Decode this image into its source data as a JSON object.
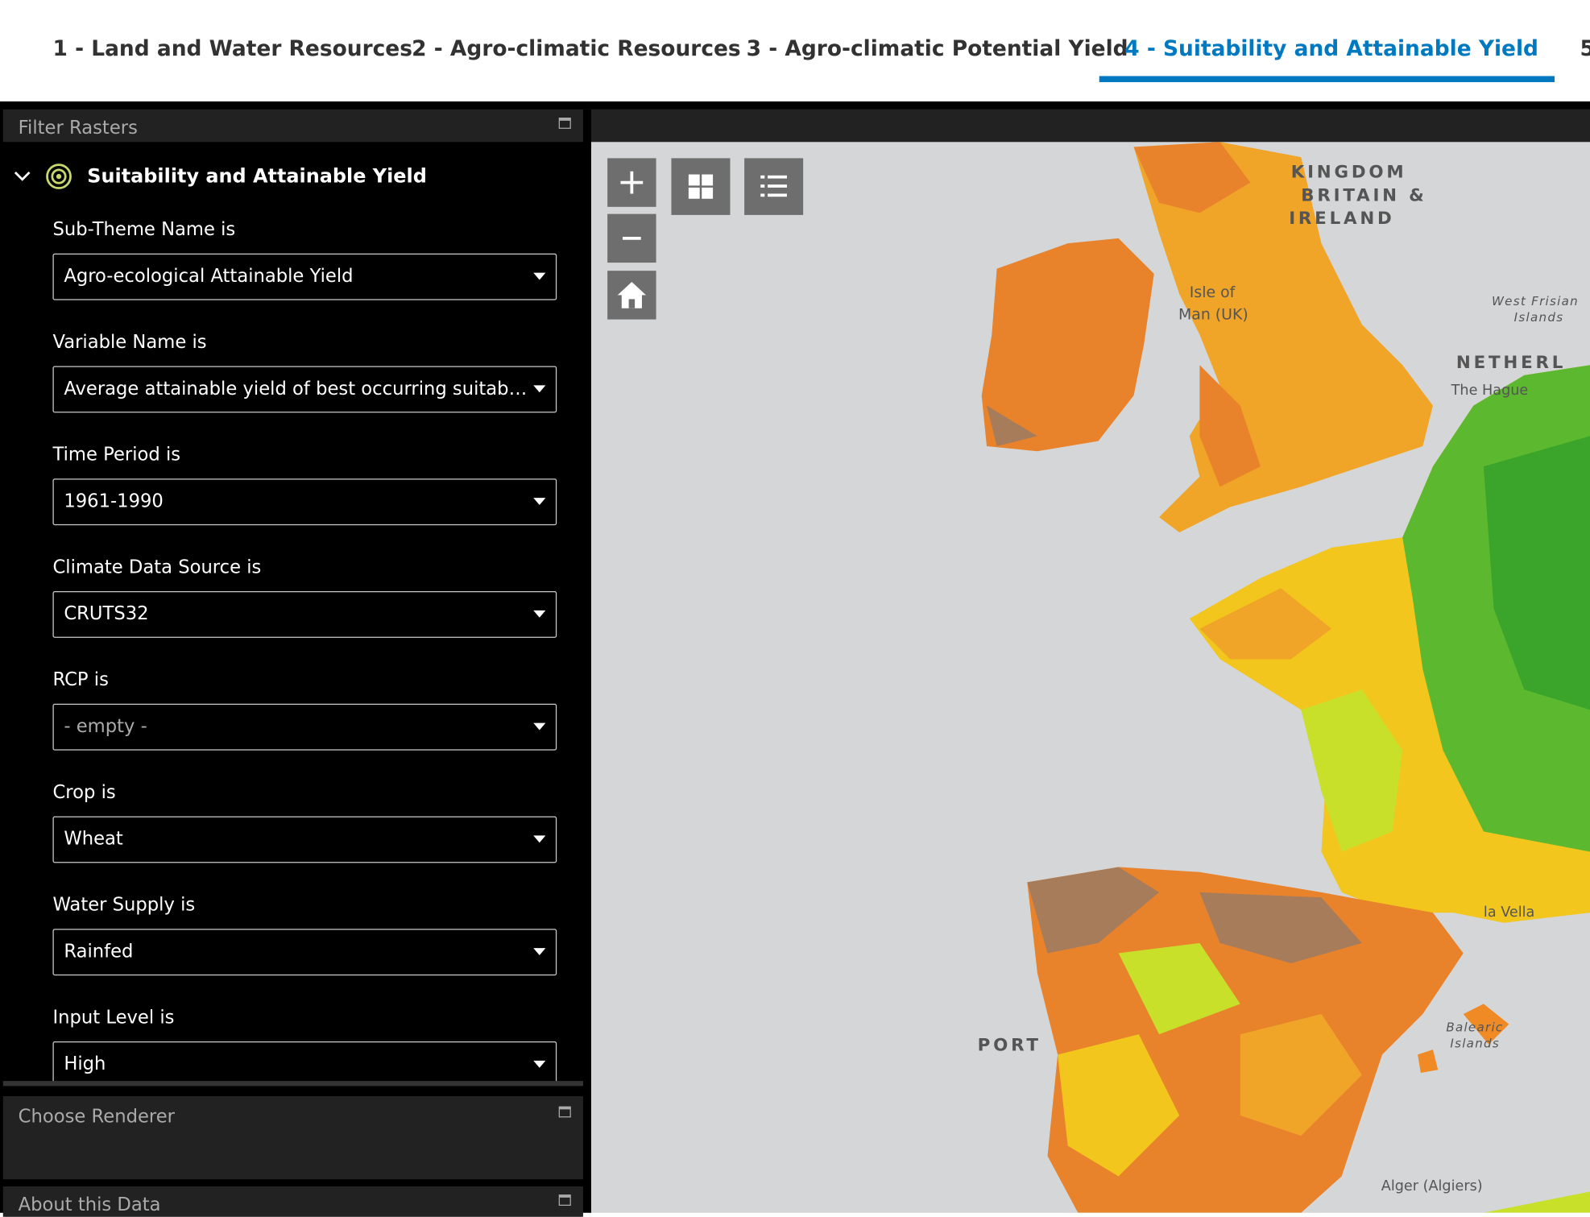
{
  "tabs": [
    {
      "label": "1 - Land and Water Resources",
      "active": false
    },
    {
      "label": "2 - Agro-climatic Resources",
      "active": false
    },
    {
      "label": "3 - Agro-climatic Potential Yield",
      "active": false
    },
    {
      "label": "4 - Suitability and Attainable Yield",
      "active": true
    },
    {
      "label": "5",
      "active": false
    }
  ],
  "accent_color": "#0079c1",
  "panels": {
    "filter_rasters": "Filter Rasters",
    "choose_renderer": "Choose Renderer",
    "about_data": "About this Data"
  },
  "filter": {
    "group_title": "Suitability and Attainable Yield",
    "fields": [
      {
        "label": "Sub-Theme Name is",
        "value": "Agro-ecological Attainable Yield",
        "empty": false
      },
      {
        "label": "Variable Name is",
        "value": "Average attainable yield of best occurring suitability class",
        "empty": false
      },
      {
        "label": "Time Period is",
        "value": "1961-1990",
        "empty": false
      },
      {
        "label": "Climate Data Source is",
        "value": "CRUTS32",
        "empty": false
      },
      {
        "label": "RCP is",
        "value": "- empty -",
        "empty": true
      },
      {
        "label": "Crop is",
        "value": "Wheat",
        "empty": false
      },
      {
        "label": "Water Supply is",
        "value": "Rainfed",
        "empty": false
      },
      {
        "label": "Input Level is",
        "value": "High",
        "empty": false
      }
    ]
  },
  "map": {
    "labels": {
      "uk": "KINGDOM",
      "uk2": "BRITAIN &",
      "uk3": "IRELAND",
      "isle1": "Isle of",
      "isle2": "Man (UK)",
      "frisian1": "West Frisian",
      "frisian2": "Islands",
      "neth": "NETHERL",
      "hague": "The Hague",
      "vella": "la Vella",
      "baleares1": "Balearic",
      "baleares2": "Islands",
      "portugal": "PORT",
      "algiers": "Alger (Algiers)"
    },
    "legend_colors": {
      "low": "#a67c5b",
      "mid_low": "#f08a24",
      "mid": "#f2c61d",
      "mid_high": "#c8e02a",
      "high": "#3aa52a"
    }
  }
}
